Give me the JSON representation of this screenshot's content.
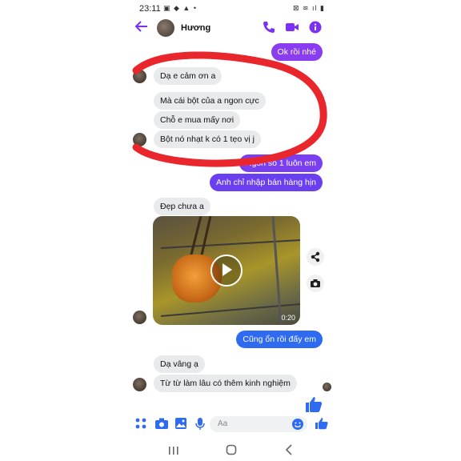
{
  "status_bar": {
    "time": "23:11",
    "left_icons": "▣ ◆ ▲ •",
    "right_icons": "⊠ ≋ ıl ▮"
  },
  "header": {
    "contact_name": "Hương"
  },
  "messages": {
    "m0": "Ok rồi nhé",
    "m1": "Dạ e cảm ơn a",
    "m2": "Mà cái bột của a ngon cực",
    "m3": "Chỗ e mua mấy nơi",
    "m4": "Bột nó nhạt k có 1 tẹo vị j",
    "m5": "Ngon số 1 luôn em",
    "m6": "Anh chỉ nhập bán hàng hịn",
    "m7": "Đẹp chưa a",
    "m8": "Cũng ổn rồi đấy em",
    "m9": "Dạ vâng ạ",
    "m10": "Từ từ làm lâu có thêm kinh nghiệm"
  },
  "video": {
    "duration": "0:20"
  },
  "composer": {
    "placeholder": "Aa"
  },
  "colors": {
    "accent": "#7b2ff7",
    "out_purple": "#7b3ff2",
    "out_blue": "#2f6bf0",
    "annotation_red": "#e8262b"
  },
  "icons": [
    "back-arrow-icon",
    "phone-icon",
    "video-camera-icon",
    "info-icon",
    "share-icon",
    "camera-icon",
    "apps-icon",
    "photo-icon",
    "mic-icon",
    "emoji-icon",
    "thumbs-up-icon"
  ]
}
